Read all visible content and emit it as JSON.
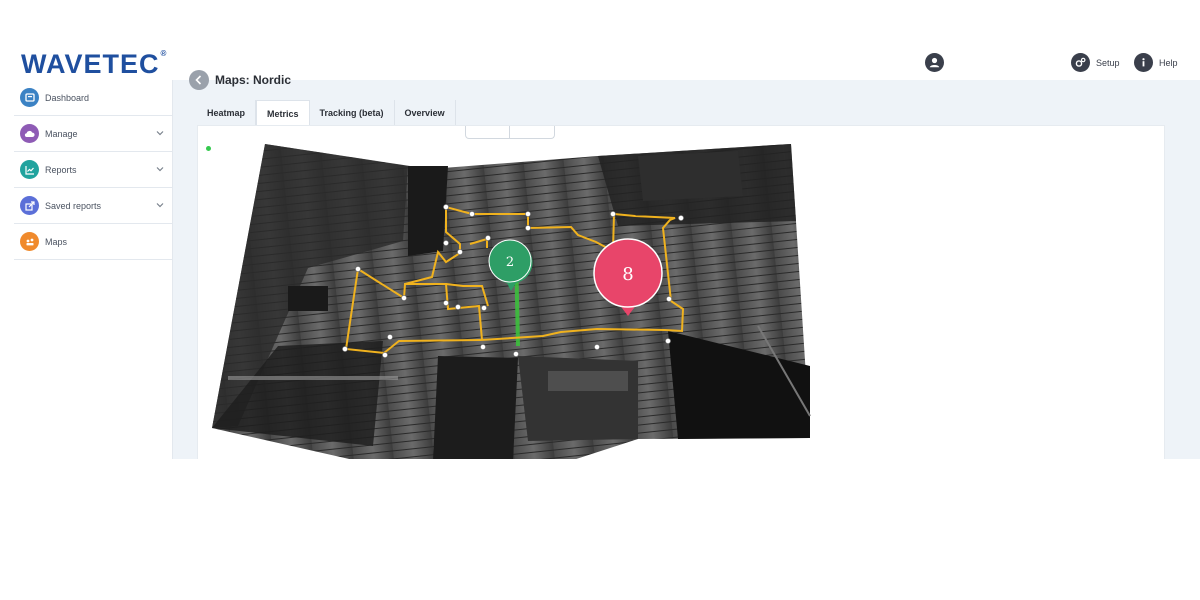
{
  "brand": {
    "logo_text": "WAVETEC",
    "registered": "®"
  },
  "header": {
    "setup_label": "Setup",
    "help_label": "Help"
  },
  "sidebar": {
    "items": [
      {
        "label": "Dashboard",
        "icon": "dashboard-icon",
        "color": "#3b82c4",
        "expandable": false
      },
      {
        "label": "Manage",
        "icon": "cloud-icon",
        "color": "#8e5bb5",
        "expandable": true
      },
      {
        "label": "Reports",
        "icon": "chart-icon",
        "color": "#20a39e",
        "expandable": true
      },
      {
        "label": "Saved reports",
        "icon": "share-icon",
        "color": "#5b6fd8",
        "expandable": true
      },
      {
        "label": "Maps",
        "icon": "map-icon",
        "color": "#f08a2c",
        "expandable": false
      }
    ]
  },
  "page": {
    "title": "Maps: Nordic"
  },
  "tabs": [
    {
      "label": "Heatmap",
      "active": false
    },
    {
      "label": "Metrics",
      "active": true
    },
    {
      "label": "Tracking (beta)",
      "active": false
    },
    {
      "label": "Overview",
      "active": false
    }
  ],
  "map": {
    "pins": [
      {
        "label": "2",
        "color": "#2e9e66"
      },
      {
        "label": "8",
        "color": "#e8456a"
      }
    ],
    "path_color": "#f0b21e",
    "highlight_color": "#3cbf3c",
    "status_color": "#35c94e"
  }
}
